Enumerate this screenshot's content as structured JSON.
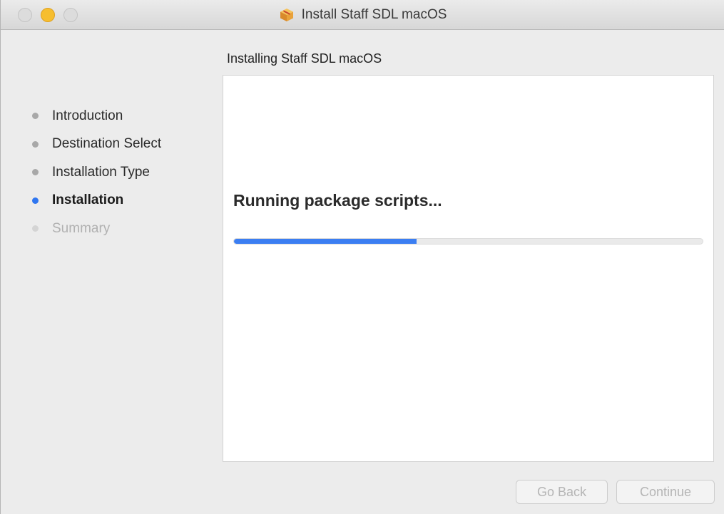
{
  "window": {
    "title": "Install Staff SDL macOS"
  },
  "header": {
    "subtitle": "Installing Staff SDL macOS"
  },
  "sidebar": {
    "steps": [
      {
        "label": "Introduction",
        "state": "completed"
      },
      {
        "label": "Destination Select",
        "state": "completed"
      },
      {
        "label": "Installation Type",
        "state": "completed"
      },
      {
        "label": "Installation",
        "state": "active"
      },
      {
        "label": "Summary",
        "state": "pending"
      }
    ]
  },
  "main": {
    "status": "Running package scripts...",
    "progress_percent": 39
  },
  "buttons": {
    "back_label": "Go Back",
    "continue_label": "Continue"
  },
  "colors": {
    "accent": "#3b7ef2",
    "minimize": "#f6be2f"
  },
  "icons": {
    "app": "package-icon"
  }
}
